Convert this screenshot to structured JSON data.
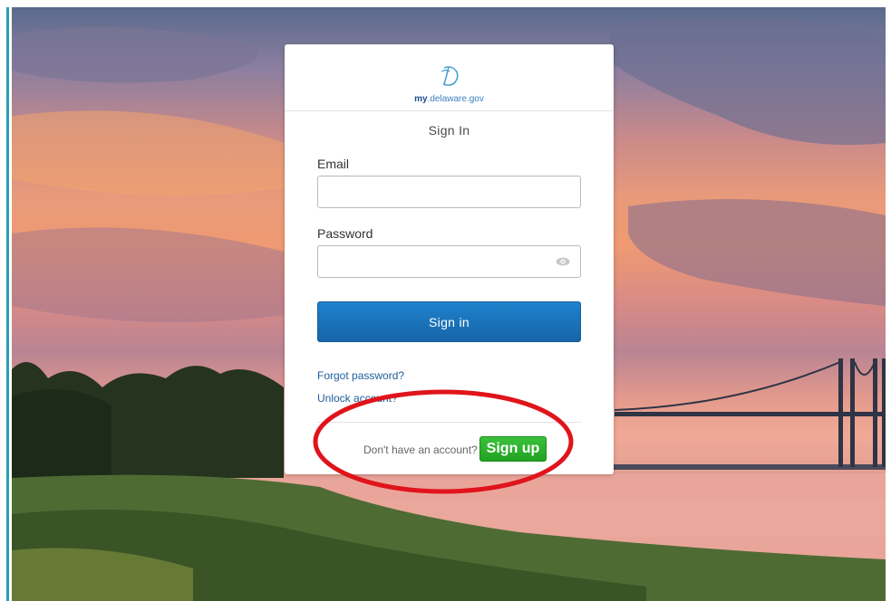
{
  "logo": {
    "my": "my",
    "domain": ".delaware.gov",
    "mark": "D"
  },
  "card": {
    "title": "Sign In"
  },
  "email": {
    "label": "Email",
    "value": "",
    "placeholder": ""
  },
  "password": {
    "label": "Password",
    "value": "",
    "placeholder": "",
    "toggle_icon": "eye-icon"
  },
  "signin_button": {
    "label": "Sign in"
  },
  "links": {
    "forgot": "Forgot password?",
    "unlock": "Unlock account?"
  },
  "signup": {
    "prompt": "Don't have an account?",
    "button": "Sign up"
  },
  "colors": {
    "primary_button": "#1f82cc",
    "signup_button": "#2bb02b",
    "link": "#1f5e9c",
    "annotation": "#e0141b",
    "left_border": "#2a9fb4"
  }
}
